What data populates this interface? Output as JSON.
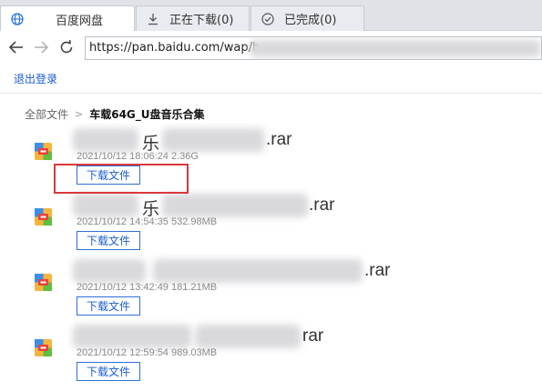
{
  "tabs": [
    {
      "label": "百度网盘",
      "icon": "globe-icon",
      "active": true
    },
    {
      "label": "正在下载(0)",
      "icon": "download-icon",
      "active": false
    },
    {
      "label": "已完成(0)",
      "icon": "check-circle-icon",
      "active": false
    }
  ],
  "address": {
    "url": "https://pan.baidu.com/wap/h"
  },
  "header": {
    "logout_label": "退出登录"
  },
  "breadcrumb": {
    "root": "全部文件",
    "separator": ">",
    "current": "车载64G_U盘音乐合集"
  },
  "files": [
    {
      "name_visible": "乐",
      "extension": ".rar",
      "meta": "2021/10/12 18:06:24 2.36G",
      "download_label": "下载文件"
    },
    {
      "name_visible": "乐",
      "extension": ".rar",
      "meta": "2021/10/12 14:54:35 532.98MB",
      "download_label": "下载文件"
    },
    {
      "name_visible": "",
      "extension": ".rar",
      "meta": "2021/10/12 13:42:49 181.21MB",
      "download_label": "下载文件"
    },
    {
      "name_visible": "",
      "extension": "rar",
      "meta": "2021/10/12 12:59:54 989.03MB",
      "download_label": "下载文件"
    }
  ],
  "colors": {
    "link": "#1a5ccf",
    "highlight": "#d9383a",
    "icon_orange": "#f4b53f",
    "icon_red": "#e8423a",
    "icon_blue": "#3d8ee8",
    "icon_green": "#5fbf3f"
  }
}
